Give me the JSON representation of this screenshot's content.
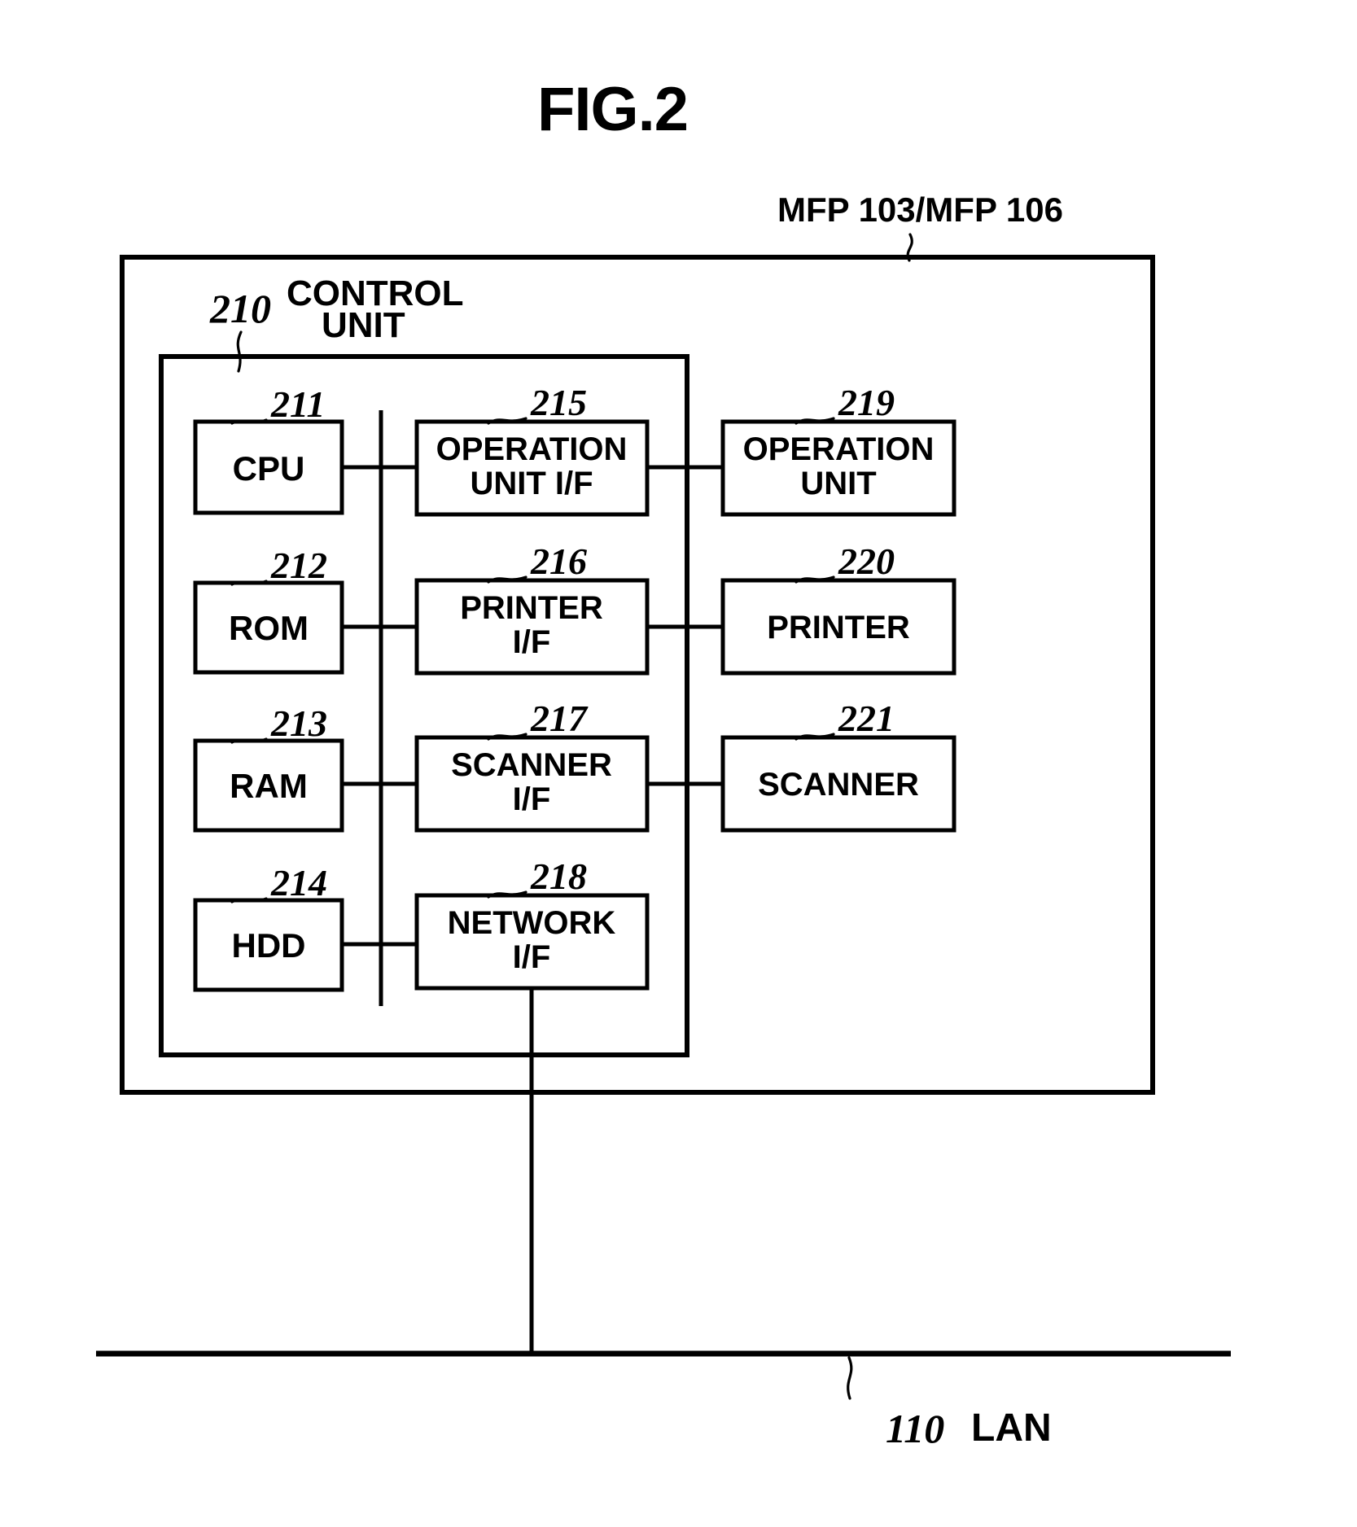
{
  "figure": {
    "title": "FIG.2",
    "domain_type": "patent-block-diagram"
  },
  "outer": {
    "label": "MFP 103/MFP 106",
    "ref": ""
  },
  "control_unit": {
    "ref": "210",
    "label_line1": "CONTROL",
    "label_line2": "UNIT"
  },
  "bus": {
    "name": "system-bus"
  },
  "blocks": {
    "left_column": [
      {
        "ref": "211",
        "label": "CPU"
      },
      {
        "ref": "212",
        "label": "ROM"
      },
      {
        "ref": "213",
        "label": "RAM"
      },
      {
        "ref": "214",
        "label": "HDD"
      }
    ],
    "middle_column": [
      {
        "ref": "215",
        "line1": "OPERATION",
        "line2": "UNIT I/F"
      },
      {
        "ref": "216",
        "line1": "PRINTER",
        "line2": "I/F"
      },
      {
        "ref": "217",
        "line1": "SCANNER",
        "line2": "I/F"
      },
      {
        "ref": "218",
        "line1": "NETWORK",
        "line2": "I/F"
      }
    ],
    "right_column": [
      {
        "ref": "219",
        "line1": "OPERATION",
        "line2": "UNIT"
      },
      {
        "ref": "220",
        "line1": "PRINTER",
        "line2": ""
      },
      {
        "ref": "221",
        "line1": "SCANNER",
        "line2": ""
      }
    ]
  },
  "network": {
    "ref": "110",
    "label": "LAN"
  },
  "colors": {
    "ink": "#000000",
    "paper": "#ffffff"
  }
}
